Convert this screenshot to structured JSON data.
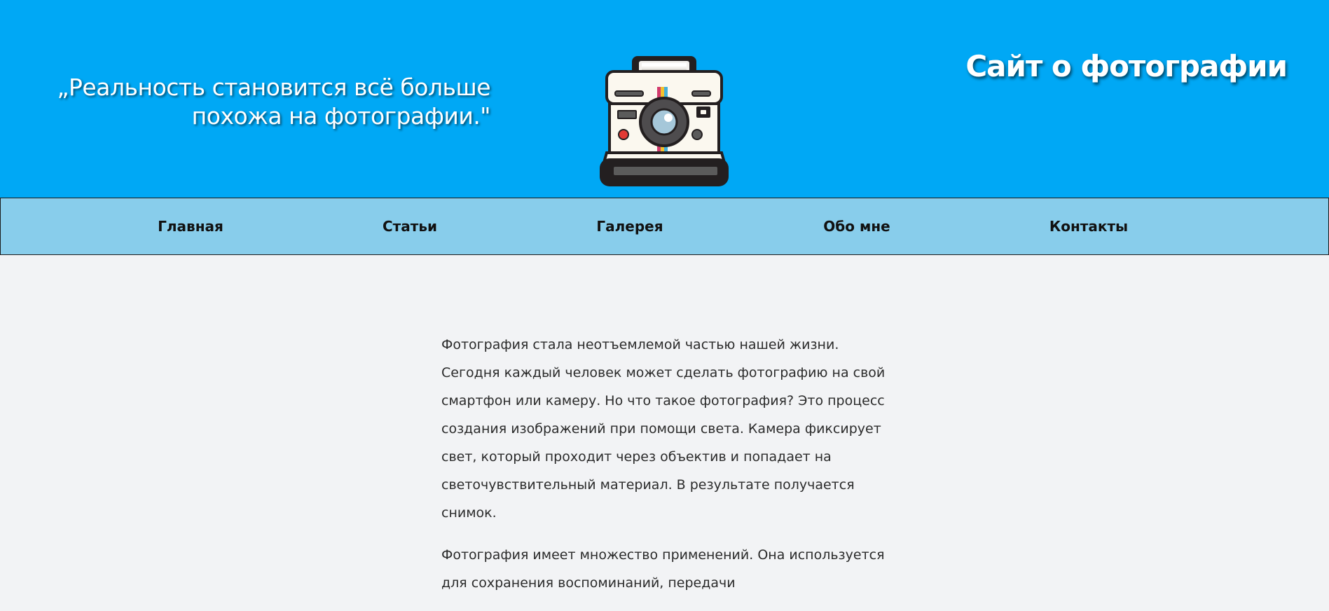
{
  "header": {
    "quote_line1": "„Реальность становится всё больше",
    "quote_line2": "похожа на фотографии.\"",
    "site_title": "Сайт о фотографии",
    "logo_icon": "polaroid-camera-icon"
  },
  "nav": {
    "items": [
      {
        "label": "Главная"
      },
      {
        "label": "Статьи"
      },
      {
        "label": "Галерея"
      },
      {
        "label": "Обо мне"
      },
      {
        "label": "Контакты"
      }
    ]
  },
  "content": {
    "paragraph1": "Фотография стала неотъемлемой частью нашей жизни. Сегодня каждый человек может сделать фотографию на свой смартфон или камеру. Но что такое фотография? Это процесс создания изображений при помощи света. Камера фиксирует свет, который проходит через объектив и попадает на светочувствительный материал. В результате получается снимок.",
    "paragraph2": "Фотография имеет множество применений. Она используется для сохранения воспоминаний, передачи"
  },
  "colors": {
    "header_bg": "#00a8f5",
    "nav_bg": "#88cdeb",
    "page_bg": "#f2f3f5"
  }
}
